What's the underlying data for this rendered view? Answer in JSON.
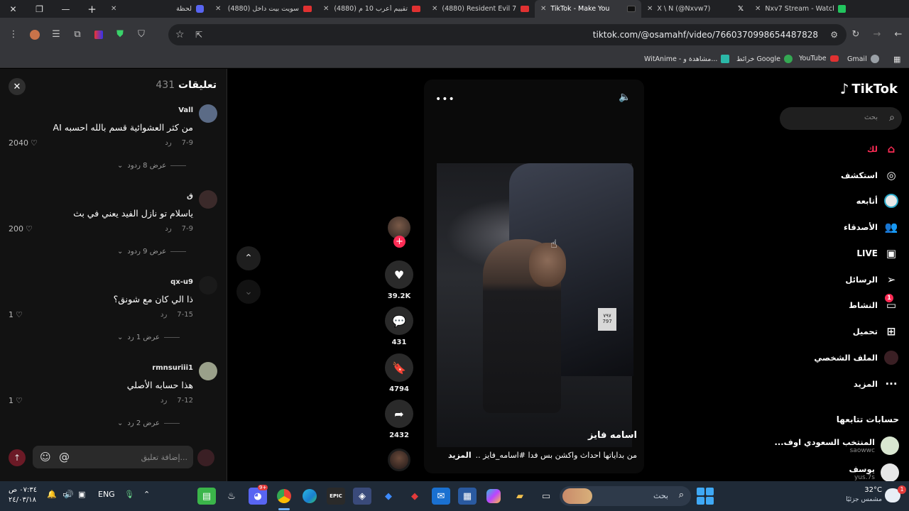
{
  "browser": {
    "tabs": [
      {
        "title": "لحظة",
        "icon": "discord-icon"
      },
      {
        "title": "(4880) سويت بيت داخل",
        "icon": "youtube-icon"
      },
      {
        "title": "(4880) تقييم أعرب 10 م",
        "icon": "youtube-icon"
      },
      {
        "title": "(4880) Resident Evil 7",
        "icon": "youtube-icon"
      },
      {
        "title": "TikTok - Make You",
        "icon": "tiktok-icon",
        "active": true
      },
      {
        "title": "X \\ N (@Nxvw7)",
        "icon": "x-icon"
      },
      {
        "title": "Nxv7 Stream - Watch",
        "icon": "green-icon"
      }
    ],
    "url": "tiktok.com/@osamahf/video/7660370998654487828",
    "bookmarks": [
      {
        "label": "Gmail",
        "icon": "chrome-icon"
      },
      {
        "label": "YouTube",
        "icon": "youtube-icon"
      },
      {
        "label": "خرائط Google",
        "icon": "maps-icon"
      },
      {
        "label": "WitAnime - مشاهدة و...",
        "icon": "witanime-icon"
      }
    ]
  },
  "comments": {
    "title": "تعليقات",
    "count": "431",
    "items": [
      {
        "user": "Vall",
        "text": "من كثر العشوائية قسم بالله احسبه AI",
        "date": "7-9",
        "reply": "رد",
        "likes": "2040",
        "replies": "عرض 8 ردود",
        "avatar_color": "#5b6b86"
      },
      {
        "user": "ق",
        "text": "ياسلام تو نازل الفيد يعني في بث",
        "date": "7-9",
        "reply": "رد",
        "likes": "200",
        "replies": "عرض 9 ردود",
        "avatar_color": "#3b2a2a"
      },
      {
        "user": "qx-u9",
        "text": "ذا الي كان مع شونق؟",
        "date": "7-15",
        "reply": "رد",
        "likes": "1",
        "replies": "عرض 1 رد",
        "avatar_color": "#1a1a1a"
      },
      {
        "user": "rmnsuriii1",
        "text": "هذا حسابه الأصلي",
        "date": "7-12",
        "reply": "رد",
        "likes": "1",
        "replies": "عرض 2 رد",
        "avatar_color": "#9aa08a"
      }
    ],
    "input_placeholder": "إضافة تعليق..."
  },
  "video": {
    "author": "اسامه فايز",
    "caption": "من بداياتها احداث واكشن بس فدا  #اسامه_فايز ..",
    "more": "المزيد",
    "plate_top": "٧٩٧",
    "plate_bottom": "797"
  },
  "actions": {
    "likes": "39.2K",
    "comments": "431",
    "saves": "4794",
    "shares": "2432"
  },
  "sidebar": {
    "logo": "TikTok",
    "search_placeholder": "بحث",
    "nav": [
      {
        "label": "لك",
        "icon": "home-icon",
        "active": true
      },
      {
        "label": "استكشف",
        "icon": "compass-icon"
      },
      {
        "label": "أتابعه",
        "icon": "following-icon"
      },
      {
        "label": "الأصدقاء",
        "icon": "friends-icon"
      },
      {
        "label": "LIVE",
        "icon": "live-icon"
      },
      {
        "label": "الرسائل",
        "icon": "messages-icon"
      },
      {
        "label": "النشاط",
        "icon": "activity-icon",
        "badge": "1"
      },
      {
        "label": "تحميل",
        "icon": "upload-icon"
      },
      {
        "label": "الملف الشخصي",
        "icon": "profile-icon"
      },
      {
        "label": "المزيد",
        "icon": "more-icon"
      }
    ],
    "following_title": "حسابات تتابعها",
    "following": [
      {
        "name": "المنتخب السعودي اوف...",
        "handle": "saowwc",
        "avatar_color": "#d8e6d0"
      },
      {
        "name": "يوسف",
        "handle": "yus.7s",
        "avatar_color": "#e6e6e6"
      }
    ]
  },
  "taskbar": {
    "search_placeholder": "بحث",
    "language": "ENG",
    "time": "٠٧:٣٤ ص",
    "date": "٢٤/٠٣/١٨",
    "temperature": "32°C",
    "weather": "مشمس جزئيًا",
    "weather_badge": "1",
    "discord_badge": "9+"
  }
}
